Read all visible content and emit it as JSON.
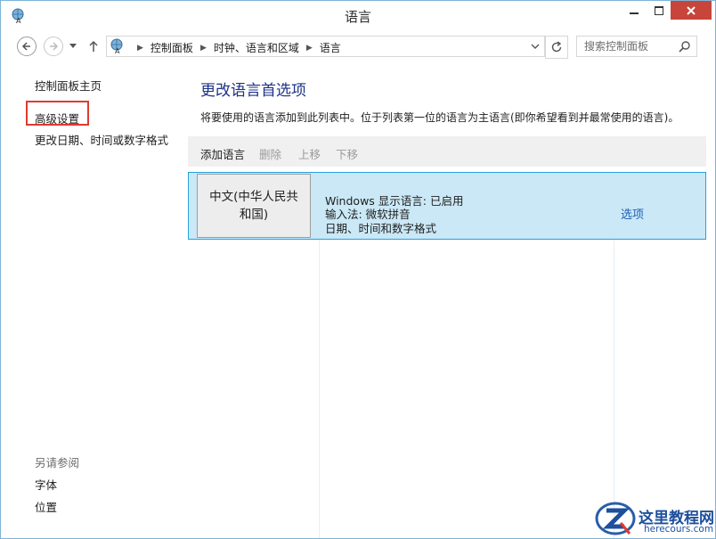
{
  "window": {
    "title": "语言"
  },
  "address": {
    "crumbs": [
      "控制面板",
      "时钟、语言和区域",
      "语言"
    ],
    "search_placeholder": "搜索控制面板"
  },
  "left_pane": {
    "home": "控制面板主页",
    "advanced": "高级设置",
    "change_date": "更改日期、时间或数字格式",
    "see_also": "另请参阅",
    "fonts": "字体",
    "location": "位置"
  },
  "main": {
    "heading": "更改语言首选项",
    "description": "将要使用的语言添加到此列表中。位于列表第一位的语言为主语言(即你希望看到并最常使用的语言)。",
    "toolbar": {
      "add": "添加语言",
      "remove": "删除",
      "move_up": "上移",
      "move_down": "下移"
    },
    "languages": [
      {
        "name": "中文(中华人民共和国)",
        "display_language": "Windows 显示语言: 已启用",
        "input_method": "输入法: 微软拼音",
        "format": "日期、时间和数字格式",
        "options": "选项"
      }
    ]
  },
  "watermark": {
    "title": "这里教程网",
    "url": "herecours.com"
  },
  "colors": {
    "accent_heading": "#1e3287",
    "selection_bg": "#cbe8f6",
    "selection_border": "#26a0da",
    "close_button": "#c7453a",
    "highlight_box": "#e03a2f",
    "link": "#1e5fb4"
  }
}
